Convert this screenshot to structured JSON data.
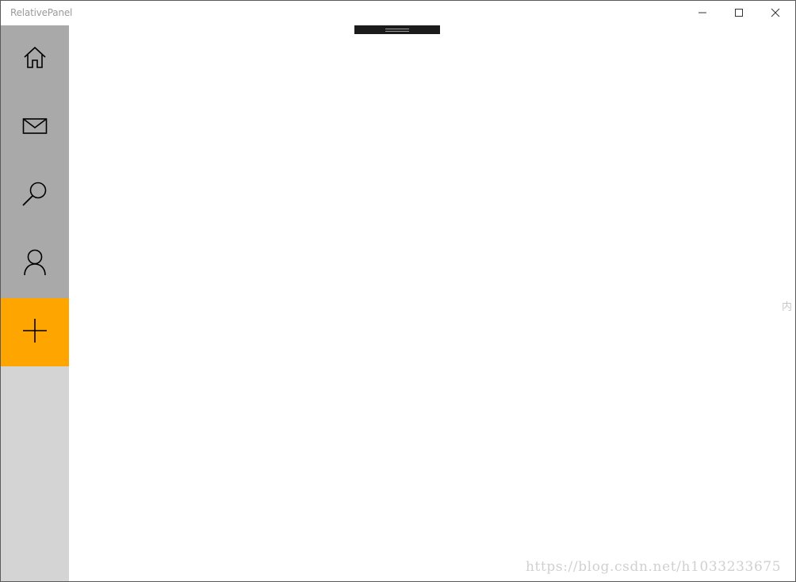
{
  "window": {
    "title": "RelativePanel",
    "controls": {
      "minimize_icon": "minimize-icon",
      "maximize_icon": "maximize-icon",
      "close_icon": "close-icon"
    }
  },
  "sidebar": {
    "background_color": "#d4d4d4",
    "item_color": "#a9a9a9",
    "items": [
      {
        "id": "home",
        "icon": "home-icon"
      },
      {
        "id": "mail",
        "icon": "mail-icon"
      },
      {
        "id": "search",
        "icon": "search-icon"
      },
      {
        "id": "contact",
        "icon": "contact-icon"
      },
      {
        "id": "add",
        "icon": "add-icon",
        "color": "#ffa500"
      }
    ]
  },
  "side_marks": "内",
  "watermark": "https://blog.csdn.net/h1033233675"
}
